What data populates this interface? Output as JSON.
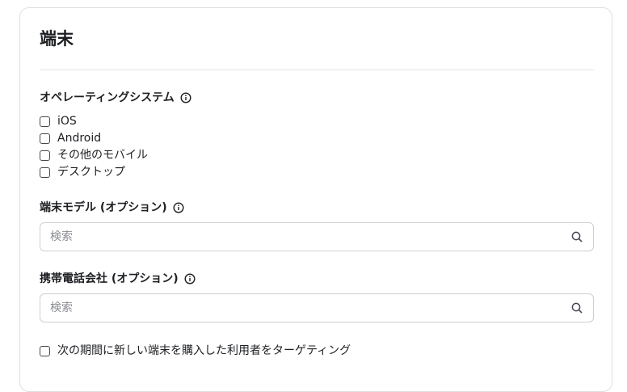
{
  "card": {
    "title": "端末"
  },
  "os": {
    "label": "オペレーティングシステム",
    "options": [
      {
        "label": "iOS",
        "checked": false
      },
      {
        "label": "Android",
        "checked": false
      },
      {
        "label": "その他のモバイル",
        "checked": false
      },
      {
        "label": "デスクトップ",
        "checked": false
      }
    ]
  },
  "device_model": {
    "label": "端末モデル (オプション)",
    "placeholder": "検索",
    "value": ""
  },
  "carrier": {
    "label": "携帯電話会社 (オプション)",
    "placeholder": "検索",
    "value": ""
  },
  "new_device": {
    "label": "次の期間に新しい端末を購入した利用者をターゲティング",
    "checked": false
  },
  "icons": {
    "info": "info-icon",
    "search": "search-icon"
  },
  "colors": {
    "text": "#1c1e21",
    "border": "#dddfe2",
    "placeholder": "#8a8d91"
  }
}
